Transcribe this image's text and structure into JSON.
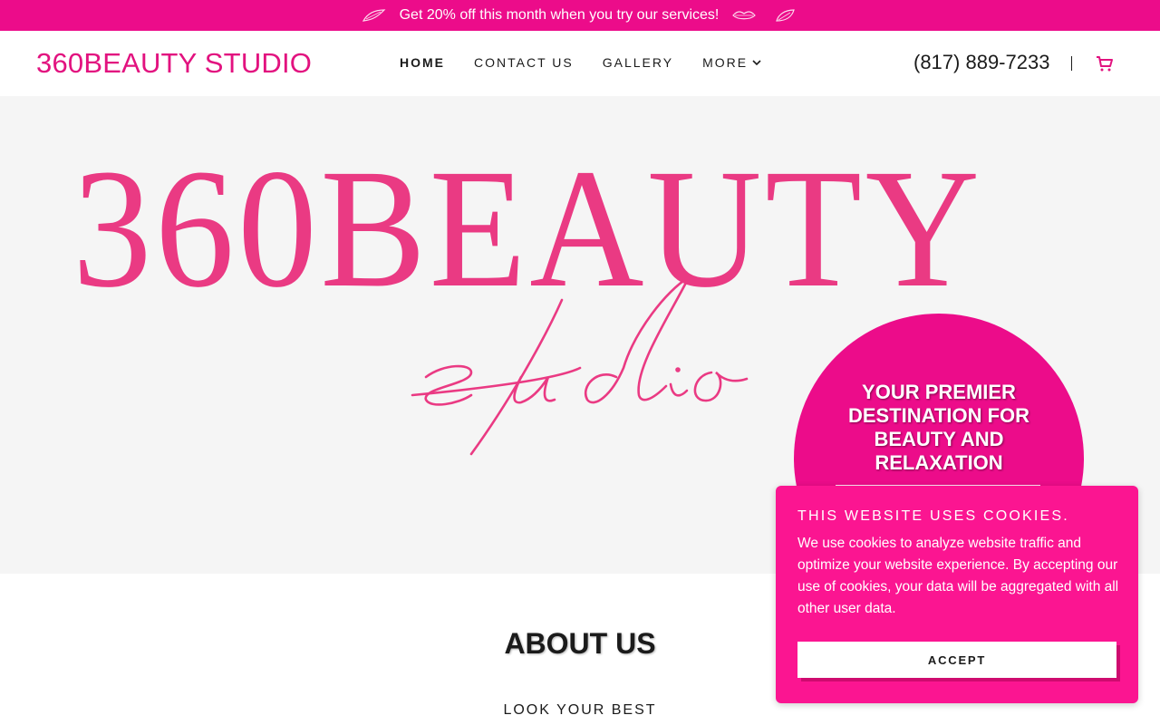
{
  "promo": {
    "text": "Get 20% off this month when you try our services!",
    "icons": [
      "leaf-icon",
      "leaf-icon",
      "lips-icon",
      "leaf-icon"
    ]
  },
  "header": {
    "brand": "360BEAUTY STUDIO",
    "nav": [
      {
        "label": "HOME",
        "active": true
      },
      {
        "label": "CONTACT US",
        "active": false
      },
      {
        "label": "GALLERY",
        "active": false
      },
      {
        "label": "MORE",
        "active": false,
        "icon": "chevron-down-icon"
      }
    ],
    "phone": "(817) 889-7233",
    "cart_icon": "cart-icon"
  },
  "hero": {
    "logo_text": "360BEAUTY",
    "logo_script": "studio",
    "tagline": "YOUR PREMIER DESTINATION FOR BEAUTY AND RELAXATION"
  },
  "about": {
    "title": "ABOUT US",
    "subtitle": "LOOK YOUR BEST"
  },
  "cookie": {
    "title": "THIS WEBSITE USES COOKIES.",
    "body": "We use cookies to analyze website traffic and optimize your website experience. By accepting our use of cookies, your data will be aggregated with all other user data.",
    "button": "ACCEPT"
  },
  "colors": {
    "accent": "#ec0c8a",
    "brand": "#e2127f",
    "logo": "#ea3a83",
    "cookie_bg": "#fb1591",
    "hero_bg": "#f5f5f5"
  }
}
